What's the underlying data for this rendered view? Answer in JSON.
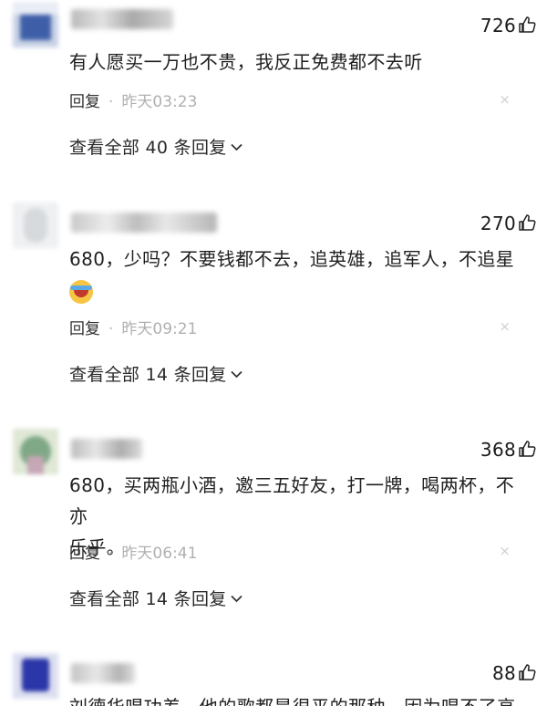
{
  "comments": [
    {
      "likes": "726",
      "text_lines": [
        "有人愿买一万也不贵，我反正免费都不去听"
      ],
      "reply_label": "回复",
      "separator": "·",
      "time": "昨天03:23",
      "close_glyph": "×",
      "view_all": "查看全部 40 条回复"
    },
    {
      "likes": "270",
      "text_lines": [
        "680，少吗？不要钱都不去，追英雄，追军人，不追星"
      ],
      "emoji": "laughing-crying-emoji",
      "reply_label": "回复",
      "separator": "·",
      "time": "昨天09:21",
      "close_glyph": "×",
      "view_all": "查看全部 14 条回复"
    },
    {
      "likes": "368",
      "text_lines": [
        "680，买两瓶小酒，邀三五好友，打一牌，喝两杯，不亦",
        "乐乎。"
      ],
      "reply_label": "回复",
      "separator": "·",
      "time": "昨天06:41",
      "close_glyph": "×",
      "view_all": "查看全部 14 条回复"
    },
    {
      "likes": "88",
      "text_lines": [
        "刘德华唱功差，他的歌都是很平的那种，因为唱不了高"
      ]
    }
  ],
  "icons": {
    "like": "thumb-up-icon",
    "chevron": "chevron-down-icon"
  },
  "colors": {
    "text": "#1f1f1f",
    "meta_gray": "#b0b0b0",
    "close_gray": "#cfcfcf"
  }
}
